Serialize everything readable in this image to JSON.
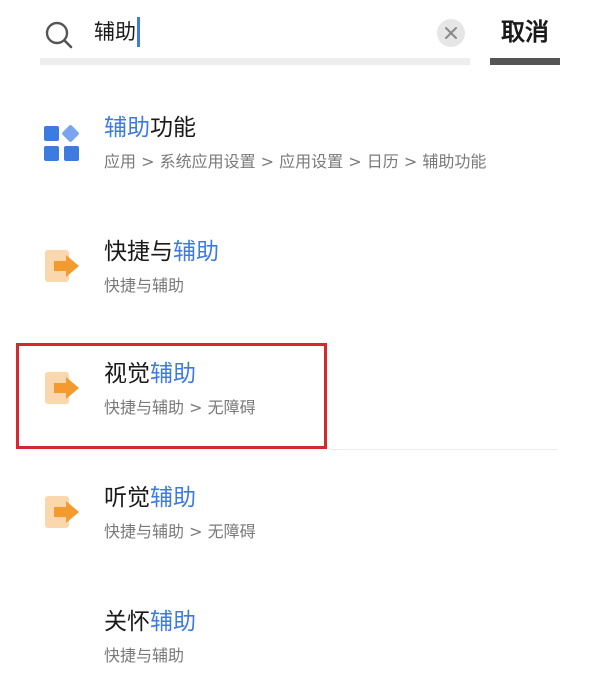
{
  "search": {
    "query": "辅助",
    "cancel_label": "取消"
  },
  "colors": {
    "highlight": "#3e7be0",
    "selection_border": "#d32a2f",
    "feature_icon_blue": "#3e7be0",
    "feature_icon_orange": "#f39b2e"
  },
  "results": [
    {
      "title_pre": "",
      "title_hl": "辅助",
      "title_post": "功能",
      "path": "应用 > 系统应用设置 > 应用设置 > 日历 > 辅助功能",
      "icon": "apps-grid-icon"
    },
    {
      "title_pre": "快捷与",
      "title_hl": "辅助",
      "title_post": "",
      "path": "快捷与辅助",
      "icon": "shortcut-arrow-icon"
    },
    {
      "title_pre": "视觉",
      "title_hl": "辅助",
      "title_post": "",
      "path": "快捷与辅助 > 无障碍",
      "icon": "shortcut-arrow-icon"
    },
    {
      "title_pre": "听觉",
      "title_hl": "辅助",
      "title_post": "",
      "path": "快捷与辅助 > 无障碍",
      "icon": "shortcut-arrow-icon"
    },
    {
      "title_pre": "关怀",
      "title_hl": "辅助",
      "title_post": "",
      "path": "快捷与辅助",
      "icon": ""
    }
  ]
}
